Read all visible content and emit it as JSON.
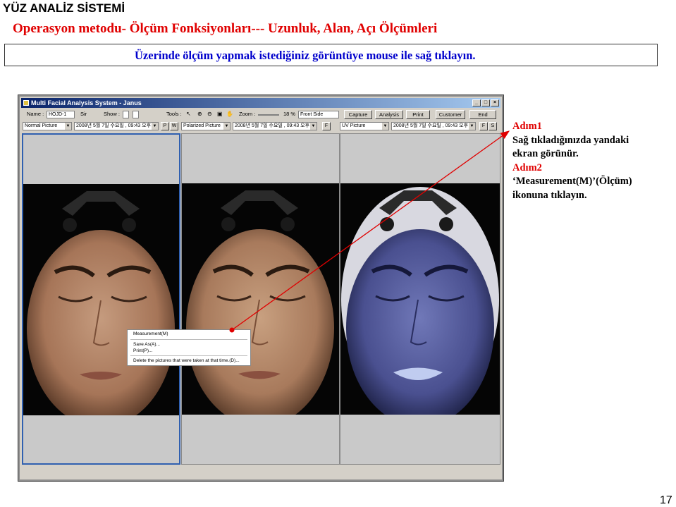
{
  "slide": {
    "system_title": "YÜZ ANALİZ SİSTEMİ",
    "subtitle": "Operasyon metodu-  Ölçüm Fonksiyonları--- Uzunluk, Alan, Açı Ölçümleri",
    "instruction": "Üzerinde ölçüm yapmak istediğiniz görüntüye mouse ile sağ tıklayın.",
    "page_number": "17"
  },
  "app": {
    "window_title": "Multi Facial Analysis System - Janus",
    "toolbar": {
      "name_label": "Name :",
      "name_value": "HOJD-1",
      "name_suffix": "Sir",
      "show_label": "Show :",
      "tools_label": "Tools :",
      "zoom_label": "Zoom :",
      "zoom_value": "18 %",
      "view_select": "Front Side",
      "capture": "Capture",
      "analysis": "Analysis",
      "print": "Print",
      "customer": "Customer",
      "end": "End"
    },
    "panels": [
      {
        "mode": "Normal Picture",
        "date": "2008년 5월 7일 수요일 , 09:43 오후",
        "buttons": [
          "P",
          "W"
        ]
      },
      {
        "mode": "Polarized Picture",
        "date": "2008년 5월 7일 수요일 , 09:43 오후",
        "buttons": [
          "F"
        ]
      },
      {
        "mode": "UV Picture",
        "date": "2008년 5월 7일 수요일 , 09:43 오후",
        "buttons": [
          "F",
          "S"
        ]
      }
    ],
    "context_menu": {
      "measurement": "Measurement(M)",
      "save_as": "Save As(A)...",
      "print": "Print(P)...",
      "delete": "Delete the pictures that were taken at that time.(D)..."
    }
  },
  "steps": {
    "step1_title": "Adım1",
    "step1_line1": "Sağ tıkladığınızda yandaki",
    "step1_line2": "ekran görünür.",
    "step2_title": "Adım2",
    "step2_line1": "‘Measurement(M)’(Ölçüm)",
    "step2_line2": "ikonuna tıklayın."
  },
  "colors": {
    "heading_red": "#e00000",
    "instruction_blue": "#0000cc",
    "arrow": "#e00000"
  }
}
